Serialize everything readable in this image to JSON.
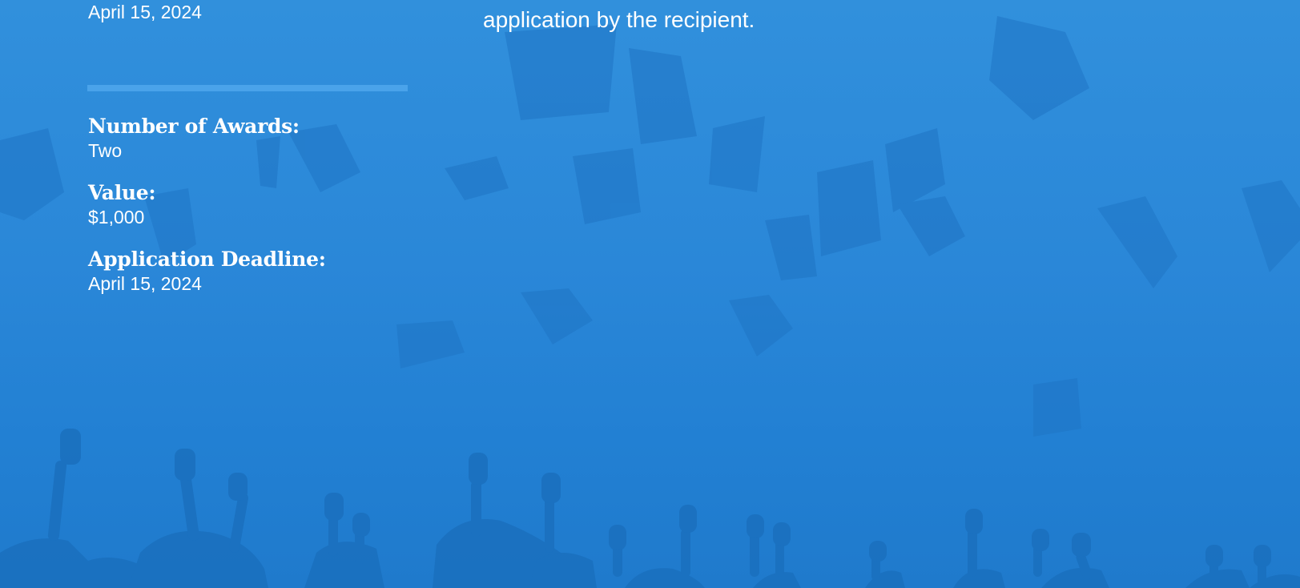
{
  "intro": {
    "top_date": "April 15, 2024",
    "description_tail": "application by the recipient."
  },
  "details": [
    {
      "label": "Number of Awards:",
      "value": "Two"
    },
    {
      "label": "Value:",
      "value": "$1,000"
    },
    {
      "label": "Application Deadline:",
      "value": "April 15, 2024"
    }
  ],
  "theme": {
    "background": "#2a87d8",
    "divider": "#4aa3ea",
    "silhouette": "#1a6fbd",
    "text": "#ffffff"
  },
  "background_image": "graduation-caps-thrown-in-air"
}
